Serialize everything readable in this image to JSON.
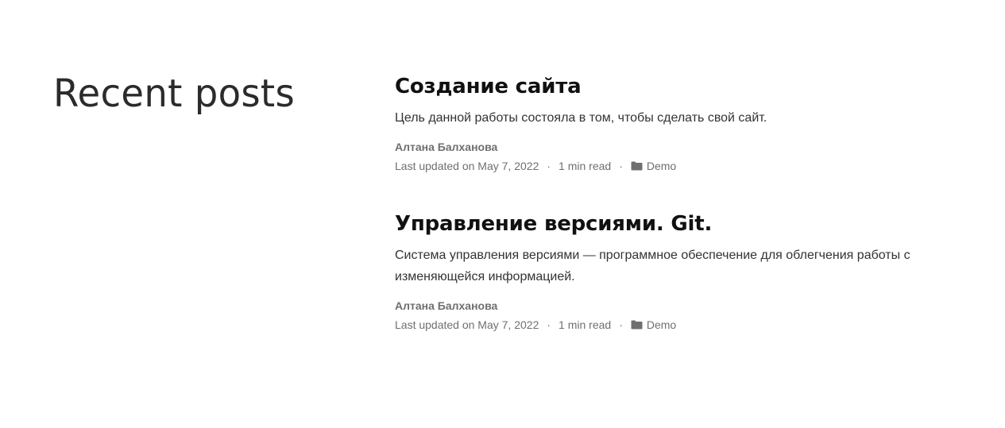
{
  "section": {
    "title": "Recent posts"
  },
  "posts": [
    {
      "title": "Создание сайта",
      "summary": "Цель данной работы состояла в том, чтобы сделать свой сайт.",
      "author": "Алтана Балханова",
      "updated": "Last updated on May 7, 2022",
      "separator": "·",
      "read_time": "1 min read",
      "category": "Demo",
      "category_icon": "folder-icon"
    },
    {
      "title": "Управление версиями. Git.",
      "summary": "Система управления версиями — программное обеспечение для облегчения работы с изменяющейся информацией.",
      "author": "Алтана Балханова",
      "updated": "Last updated on May 7, 2022",
      "separator": "·",
      "read_time": "1 min read",
      "category": "Demo",
      "category_icon": "folder-icon"
    }
  ],
  "colors": {
    "heading": "#111111",
    "meta": "#6f6f6f",
    "body": "#333333",
    "background": "#ffffff"
  }
}
